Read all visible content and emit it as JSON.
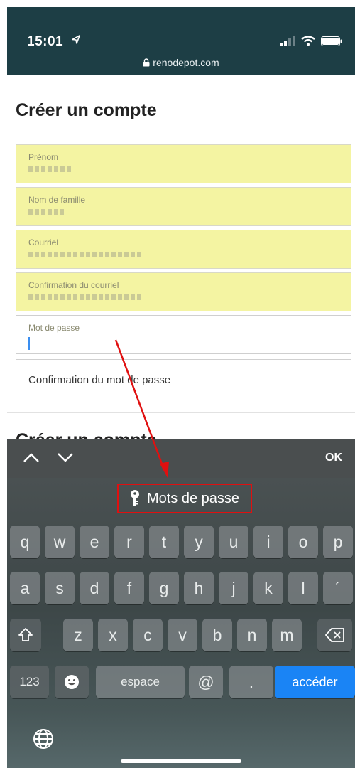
{
  "status": {
    "time": "15:01",
    "url": "renodepot.com"
  },
  "page": {
    "title": "Créer un compte",
    "fields": [
      {
        "label": "Prénom"
      },
      {
        "label": "Nom de famille"
      },
      {
        "label": "Courriel"
      },
      {
        "label": "Confirmation du courriel"
      },
      {
        "label": "Mot de passe"
      },
      {
        "label": "Confirmation du mot de passe"
      }
    ],
    "peek_title": "Créer un compte"
  },
  "accessory": {
    "ok": "OK"
  },
  "keyboard": {
    "suggestion": "Mots de passe",
    "row1": [
      "q",
      "w",
      "e",
      "r",
      "t",
      "y",
      "u",
      "i",
      "o",
      "p"
    ],
    "row2": [
      "a",
      "s",
      "d",
      "f",
      "g",
      "h",
      "j",
      "k",
      "l",
      "´"
    ],
    "row3": [
      "z",
      "x",
      "c",
      "v",
      "b",
      "n",
      "m"
    ],
    "num": "123",
    "space": "espace",
    "at": "@",
    "dot": ".",
    "go": "accéder"
  },
  "colors": {
    "status_bg": "#1d3e45",
    "autofill": "#f4f4a2",
    "go_key": "#1a84f5",
    "annotation": "#e01010"
  }
}
